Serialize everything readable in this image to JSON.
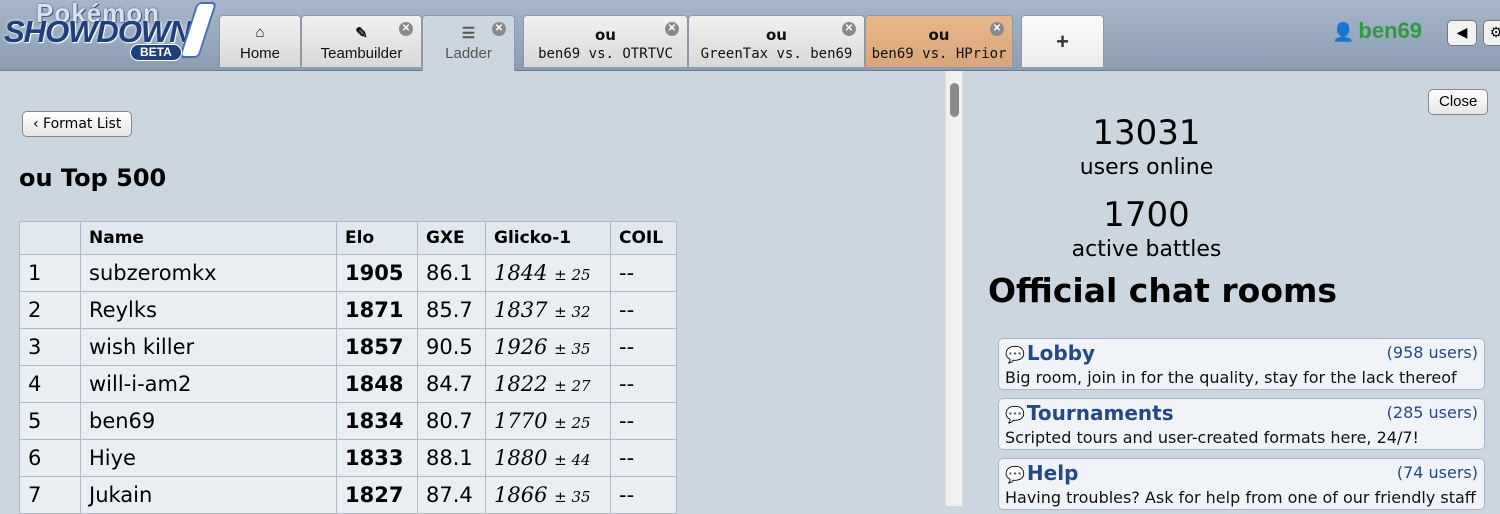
{
  "header": {
    "logo": {
      "top": "Pokémon",
      "main": "SHOWDOWN",
      "badge": "BETA"
    },
    "tabs": [
      {
        "icon": "home-icon",
        "icon_glyph": "⌂",
        "label": "Home",
        "closable": false
      },
      {
        "icon": "pencil-icon",
        "icon_glyph": "✎",
        "label": "Teambuilder",
        "closable": true
      },
      {
        "icon": "list-icon",
        "icon_glyph": "☰",
        "label": "Ladder",
        "closable": true,
        "active": true
      }
    ],
    "battle_tabs": [
      {
        "format": "ou",
        "label": "ben69 vs. OTRTVC"
      },
      {
        "format": "ou",
        "label": "GreenTax vs. ben69"
      },
      {
        "format": "ou",
        "label": "ben69 vs. HPrior",
        "highlighted": true
      }
    ],
    "new_tab_label": "+",
    "user": {
      "name": "ben69",
      "icon": "user-icon"
    },
    "volume_icon": "◀"
  },
  "ladder": {
    "format_list_button": "‹ Format List",
    "title": "ou Top 500",
    "columns": [
      "",
      "Name",
      "Elo",
      "GXE",
      "Glicko-1",
      "COIL"
    ],
    "rows": [
      {
        "rank": "1",
        "name": "subzeromkx",
        "elo": "1905",
        "gxe": "86.1",
        "glicko": "1844",
        "dev": "± 25",
        "coil": "--"
      },
      {
        "rank": "2",
        "name": "Reylks",
        "elo": "1871",
        "gxe": "85.7",
        "glicko": "1837",
        "dev": "± 32",
        "coil": "--"
      },
      {
        "rank": "3",
        "name": "wish killer",
        "elo": "1857",
        "gxe": "90.5",
        "glicko": "1926",
        "dev": "± 35",
        "coil": "--"
      },
      {
        "rank": "4",
        "name": "will-i-am2",
        "elo": "1848",
        "gxe": "84.7",
        "glicko": "1822",
        "dev": "± 27",
        "coil": "--"
      },
      {
        "rank": "5",
        "name": "ben69",
        "elo": "1834",
        "gxe": "80.7",
        "glicko": "1770",
        "dev": "± 25",
        "coil": "--"
      },
      {
        "rank": "6",
        "name": "Hiye",
        "elo": "1833",
        "gxe": "88.1",
        "glicko": "1880",
        "dev": "± 44",
        "coil": "--"
      },
      {
        "rank": "7",
        "name": "Jukain",
        "elo": "1827",
        "gxe": "87.4",
        "glicko": "1866",
        "dev": "± 35",
        "coil": "--"
      }
    ]
  },
  "side": {
    "close_button": "Close",
    "users_online": "13031",
    "users_online_label": "users online",
    "active_battles": "1700",
    "active_battles_label": "active battles",
    "rooms_title": "Official chat rooms",
    "rooms": [
      {
        "name": "Lobby",
        "users": "(958 users)",
        "desc": "Big room, join in for the quality, stay for the lack thereof"
      },
      {
        "name": "Tournaments",
        "users": "(285 users)",
        "desc": "Scripted tours and user-created formats here, 24/7!"
      },
      {
        "name": "Help",
        "users": "(74 users)",
        "desc": "Having troubles? Ask for help from one of our friendly staff"
      }
    ]
  },
  "colors": {
    "background": "#ccd6e0",
    "username": "#2f9a3e",
    "room_link": "#244a86",
    "highlight_tab": "#dfae83"
  }
}
